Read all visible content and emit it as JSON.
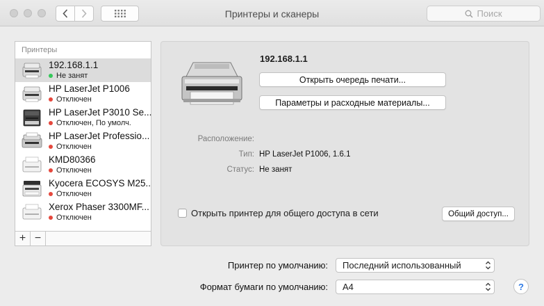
{
  "window": {
    "title": "Принтеры и сканеры"
  },
  "search": {
    "placeholder": "Поиск"
  },
  "sidebar": {
    "header": "Принтеры",
    "printers": [
      {
        "name": "192.168.1.1",
        "status": "Не занят",
        "status_color": "#34c759",
        "icon": "laser-printer-small-icon"
      },
      {
        "name": "HP LaserJet P1006",
        "status": "Отключен",
        "status_color": "#e5483d",
        "icon": "laser-printer-small-icon"
      },
      {
        "name": "HP LaserJet P3010 Se...",
        "status": "Отключен, По умолч.",
        "status_color": "#e5483d",
        "icon": "laser-printer-black-icon"
      },
      {
        "name": "HP LaserJet Professio...",
        "status": "Отключен",
        "status_color": "#e5483d",
        "icon": "laser-printer-wide-icon"
      },
      {
        "name": "KMD80366",
        "status": "Отключен",
        "status_color": "#e5483d",
        "icon": "generic-printer-icon"
      },
      {
        "name": "Kyocera ECOSYS M25...",
        "status": "Отключен",
        "status_color": "#e5483d",
        "icon": "mfp-printer-icon"
      },
      {
        "name": "Xerox Phaser 3300MF...",
        "status": "Отключен",
        "status_color": "#e5483d",
        "icon": "generic-printer-icon"
      }
    ],
    "add_label": "+",
    "remove_label": "−"
  },
  "detail": {
    "title": "192.168.1.1",
    "open_queue_label": "Открыть очередь печати...",
    "options_label": "Параметры и расходные материалы...",
    "location_label": "Расположение:",
    "location_value": "",
    "type_label": "Тип:",
    "type_value": "HP LaserJet P1006, 1.6.1",
    "status_label": "Статус:",
    "status_value": "Не занят",
    "share_label": "Открыть принтер для общего доступа в сети",
    "share_checked": false,
    "share_button_label": "Общий доступ..."
  },
  "defaults": {
    "printer_label": "Принтер по умолчанию:",
    "printer_value": "Последний использованный",
    "paper_label": "Формат бумаги по умолчанию:",
    "paper_value": "A4"
  },
  "help_label": "?"
}
